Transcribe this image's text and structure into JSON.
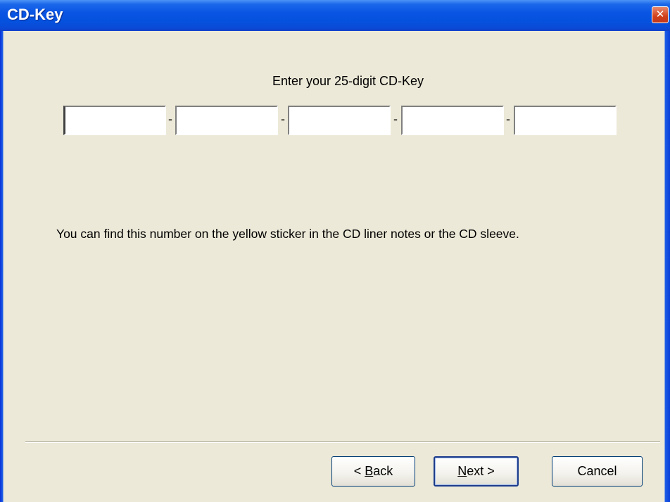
{
  "window": {
    "title": "CD-Key",
    "close_icon": "close-icon"
  },
  "content": {
    "prompt": "Enter your 25-digit CD-Key",
    "key_fields": [
      {
        "value": ""
      },
      {
        "value": ""
      },
      {
        "value": ""
      },
      {
        "value": ""
      },
      {
        "value": ""
      }
    ],
    "separator_char": "-",
    "info_text": "You can find this number on the yellow sticker in the CD liner notes or the CD sleeve."
  },
  "buttons": {
    "back_prefix": "< ",
    "back_accel": "B",
    "back_rest": "ack",
    "next_accel": "N",
    "next_rest": "ext >",
    "cancel": "Cancel"
  },
  "colors": {
    "titlebar": "#0a55e3",
    "client_bg": "#ece9d8",
    "close_button": "#d2401b"
  }
}
